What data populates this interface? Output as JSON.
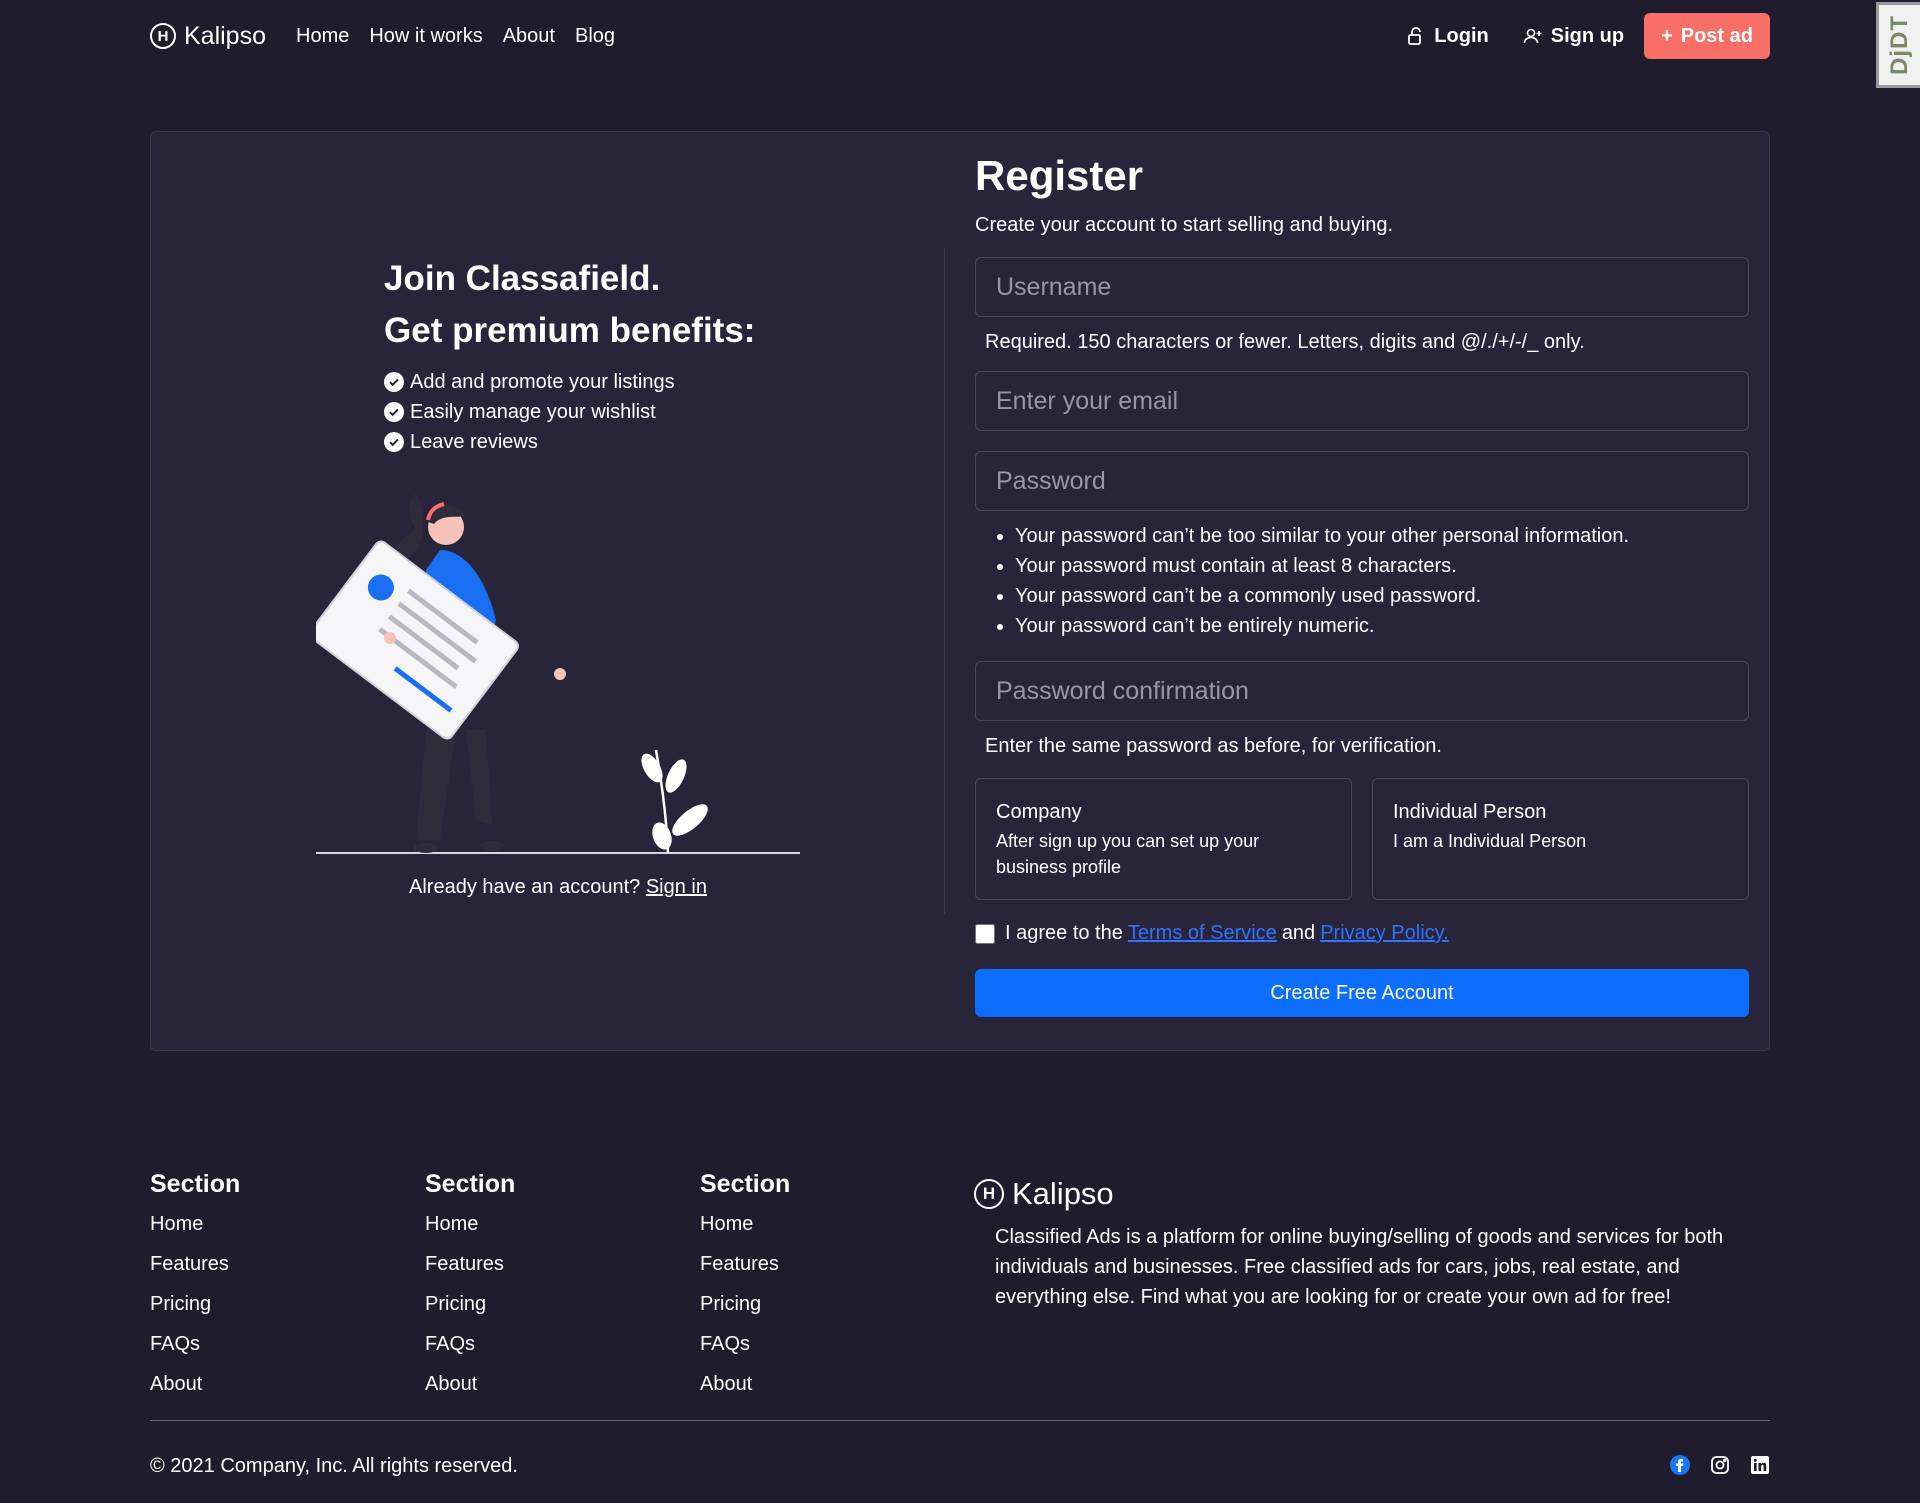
{
  "nav": {
    "brand": "Kalipso",
    "brand_letter": "H",
    "links": [
      "Home",
      "How it works",
      "About",
      "Blog"
    ],
    "login": "Login",
    "signup": "Sign up",
    "post_ad": "Post ad",
    "debug_toolbar": "DjDT"
  },
  "promo": {
    "title_line1": "Join Classafield.",
    "title_line2": "Get premium benefits:",
    "benefits": [
      "Add and promote your listings",
      "Easily manage your wishlist",
      "Leave reviews"
    ],
    "already_text": "Already have an account?",
    "signin_label": "Sign in"
  },
  "form": {
    "title": "Register",
    "subtitle": "Create your account to start selling and buying.",
    "username_placeholder": "Username",
    "username_help": "Required. 150 characters or fewer. Letters, digits and @/./+/-/_ only.",
    "email_placeholder": "Enter your email",
    "password_placeholder": "Password",
    "password_rules": [
      "Your password can’t be too similar to your other personal information.",
      "Your password must contain at least 8 characters.",
      "Your password can’t be a commonly used password.",
      "Your password can’t be entirely numeric."
    ],
    "password_confirm_placeholder": "Password confirmation",
    "password_confirm_help": "Enter the same password as before, for verification.",
    "account_types": [
      {
        "title": "Company",
        "description": "After sign up you can set up your business profile"
      },
      {
        "title": "Individual Person",
        "description": "I am a Individual Person"
      }
    ],
    "agree_prefix": "I agree to the",
    "terms_label": "Terms of Service",
    "agree_and": "and",
    "privacy_label": "Privacy Policy.",
    "submit_label": "Create Free Account"
  },
  "footer": {
    "sections": [
      {
        "title": "Section",
        "links": [
          "Home",
          "Features",
          "Pricing",
          "FAQs",
          "About"
        ]
      },
      {
        "title": "Section",
        "links": [
          "Home",
          "Features",
          "Pricing",
          "FAQs",
          "About"
        ]
      },
      {
        "title": "Section",
        "links": [
          "Home",
          "Features",
          "Pricing",
          "FAQs",
          "About"
        ]
      }
    ],
    "brand": "Kalipso",
    "description": "Classified Ads is a platform for online buying/selling of goods and services for both individuals and businesses. Free classified ads for cars, jobs, real estate, and everything else. Find what you are looking for or create your own ad for free!",
    "copyright": "© 2021 Company, Inc. All rights reserved.",
    "socials": [
      "facebook-icon",
      "instagram-icon",
      "linkedin-icon"
    ]
  },
  "colors": {
    "background": "#1f1c2e",
    "card": "#28253a",
    "accent_coral": "#f86f67",
    "primary_blue": "#0d6efd",
    "link_blue": "#2f73ff"
  }
}
